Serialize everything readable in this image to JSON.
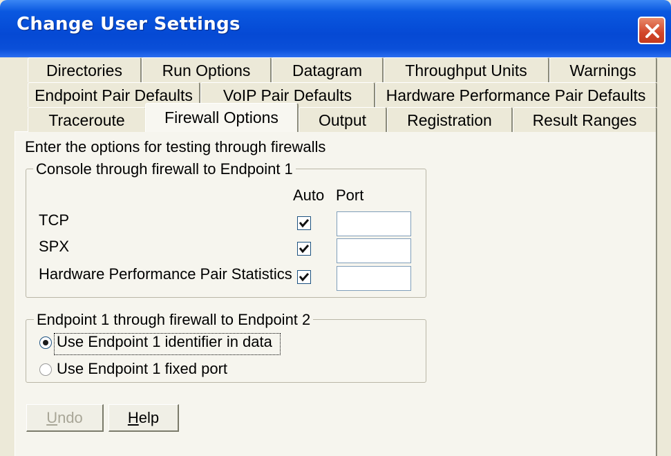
{
  "window": {
    "title": "Change User Settings"
  },
  "tabs": {
    "row1": [
      "Directories",
      "Run Options",
      "Datagram",
      "Throughput Units",
      "Warnings"
    ],
    "row2": [
      "Endpoint Pair Defaults",
      "VoIP Pair Defaults",
      "Hardware Performance Pair Defaults"
    ],
    "row3": [
      "Traceroute",
      "Firewall Options",
      "Output",
      "Registration",
      "Result Ranges"
    ],
    "active": "Firewall Options"
  },
  "firewall": {
    "instruction": "Enter the options for testing through firewalls",
    "console_group": {
      "legend": "Console through firewall to Endpoint 1",
      "auto_header": "Auto",
      "port_header": "Port",
      "rows": [
        {
          "label": "TCP",
          "auto": true,
          "port": ""
        },
        {
          "label": "SPX",
          "auto": true,
          "port": ""
        },
        {
          "label": "Hardware Performance Pair Statistics",
          "auto": true,
          "port": ""
        }
      ]
    },
    "endpoint_group": {
      "legend": "Endpoint 1 through firewall to Endpoint 2",
      "options": [
        {
          "label": "Use Endpoint 1 identifier in data",
          "selected": true
        },
        {
          "label": "Use Endpoint 1 fixed port",
          "selected": false
        }
      ]
    }
  },
  "buttons": {
    "undo": "Undo",
    "help": "Help"
  },
  "colors": {
    "title_bar": "#0549d4",
    "close_button": "#d2462a",
    "dialog_bg": "#ece9d8"
  }
}
